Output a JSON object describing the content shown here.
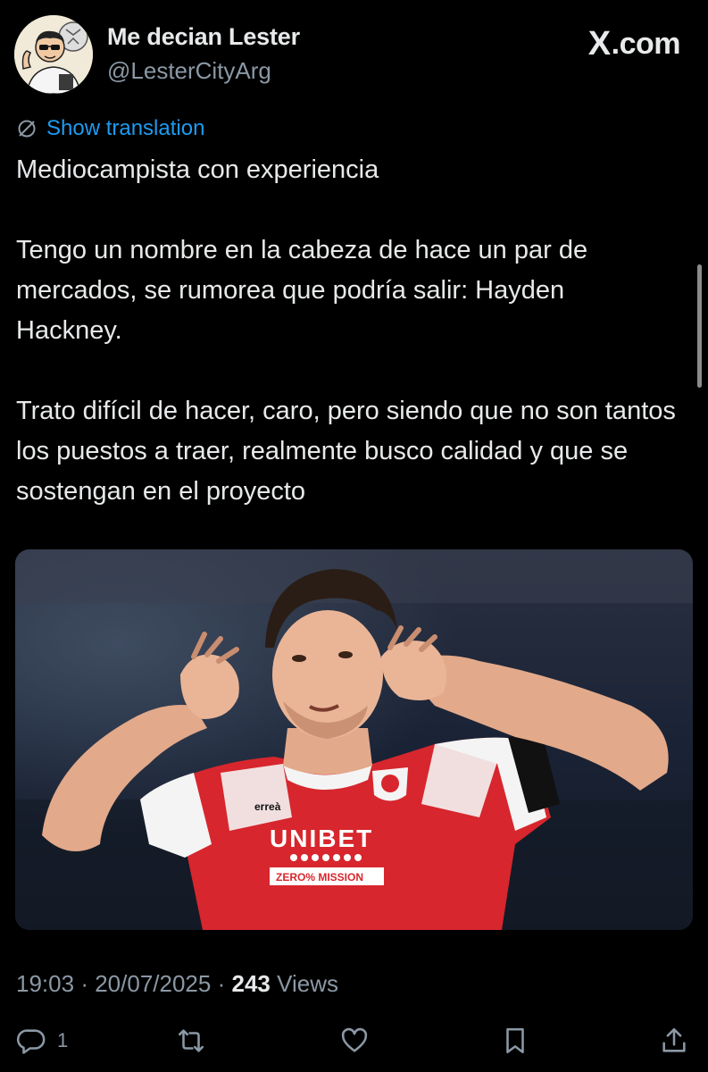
{
  "author": {
    "display_name": "Me decian Lester",
    "handle": "@LesterCityArg",
    "avatar_icon": "avatar-cartoon"
  },
  "brand": {
    "label": "X.com",
    "x_mark": "X",
    "suffix": ".com"
  },
  "translation": {
    "label": "Show translation",
    "icon": "globe-off-icon"
  },
  "tweet": {
    "paragraphs": [
      "Mediocampista con experiencia",
      "Tengo un nombre en la cabeza de hace un par de mercados, se rumorea que podría salir: Hayden Hackney.",
      "Trato difícil de hacer, caro, pero siendo que no son tantos los puestos a traer, realmente busco calidad y que se sostengan en el proyecto"
    ]
  },
  "media": {
    "kit_brand": "erreà",
    "sponsor": "UNIBET",
    "sponsor_tagline": "ZERO% MISSION"
  },
  "meta": {
    "time": "19:03",
    "separator": "·",
    "date": "20/07/2025",
    "views_count": "243",
    "views_label": "Views"
  },
  "actions": {
    "reply_count": "1",
    "icons": [
      "reply-icon",
      "repost-icon",
      "like-icon",
      "bookmark-icon",
      "share-icon"
    ]
  },
  "colors": {
    "background": "#000000",
    "text": "#e7e9ea",
    "muted": "#8b98a5",
    "accent": "#1d9bf0",
    "jersey_red": "#d7262d"
  }
}
